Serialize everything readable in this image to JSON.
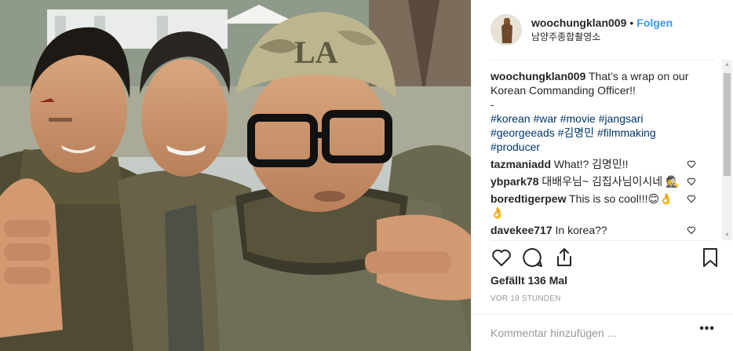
{
  "post": {
    "username": "woochungklan009",
    "separator": "•",
    "follow_label": "Folgen",
    "location": "남양주종합촬영소"
  },
  "caption": {
    "username": "woochungklan009",
    "text": "That’s a wrap on our Korean Commanding Officer!!",
    "dash": "-",
    "hashtags": "#korean #war #movie #jangsari #georgeeads #김명민 #filmmaking #producer"
  },
  "comments": [
    {
      "username": "tazmaniadd",
      "text": "What!? 김명민!!"
    },
    {
      "username": "ybpark78",
      "text": "대배우님~ 김집사님이시네 🕵"
    },
    {
      "username": "boredtigerpew",
      "text": "This is so cool!!!😊👌👌"
    },
    {
      "username": "davekee717",
      "text": "In korea??"
    }
  ],
  "likes": "Gefällt 136 Mal",
  "timestamp": "VOR 19 STUNDEN",
  "comment_box": {
    "placeholder": "Kommentar hinzufügen ...",
    "more_label": "•••"
  },
  "icons": {
    "like": "heart-icon",
    "comment": "comment-bubble-icon",
    "share": "share-icon",
    "save": "bookmark-icon"
  },
  "colors": {
    "link_blue": "#3897f0",
    "hashtag": "#003569",
    "muted": "#999999",
    "text": "#262626"
  }
}
